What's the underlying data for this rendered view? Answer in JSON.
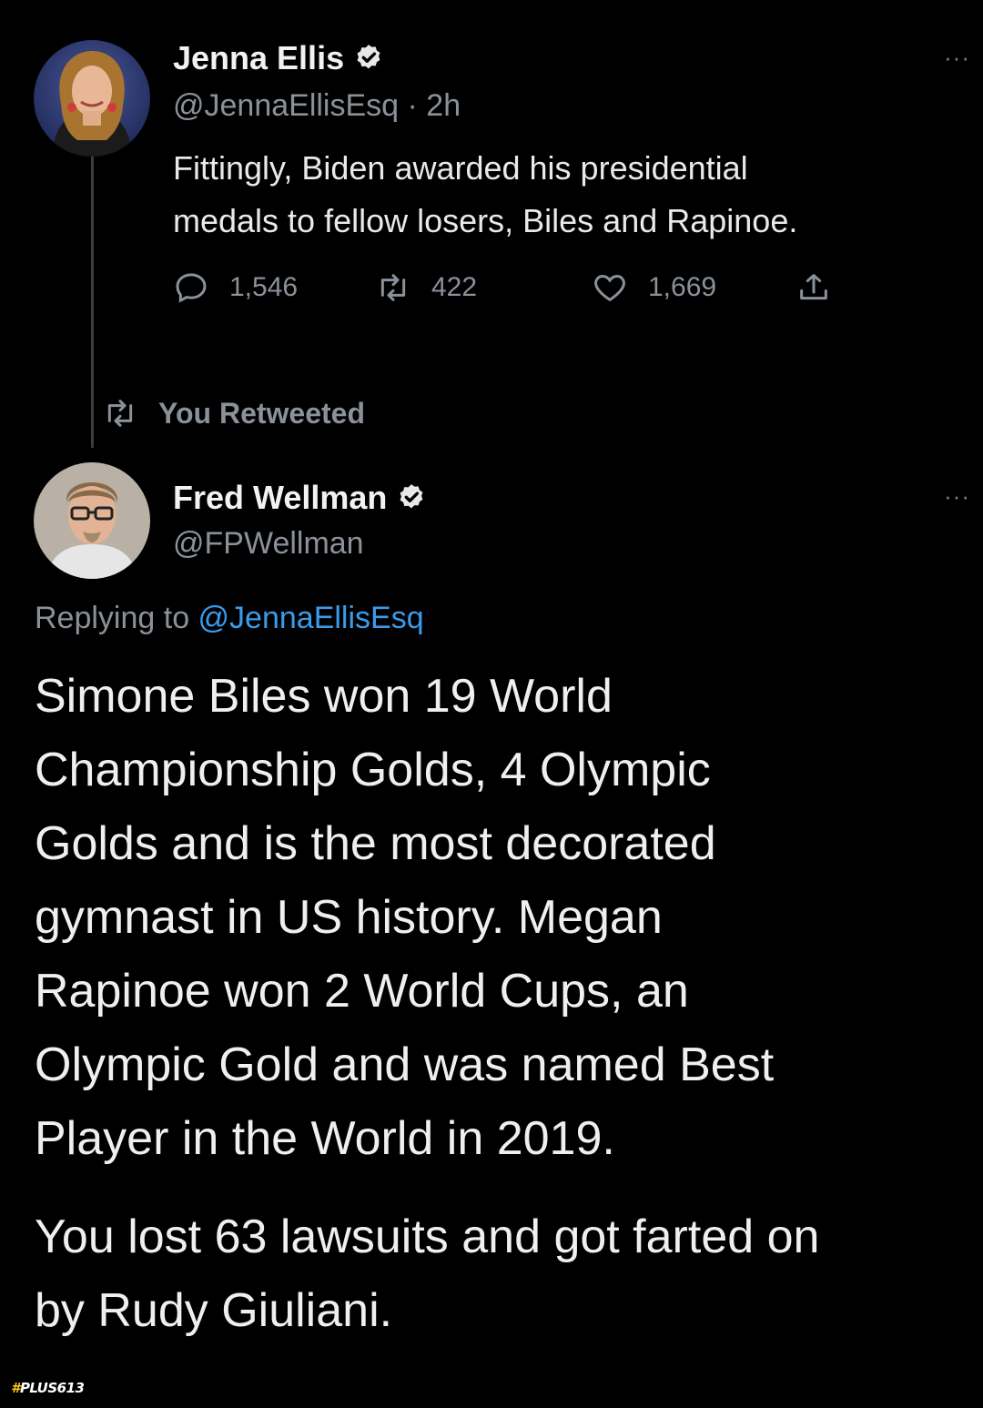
{
  "tweet1": {
    "name": "Jenna Ellis",
    "handle": "@JennaEllisEsq · 2h",
    "text_line1": "Fittingly, Biden awarded his presidential",
    "text_line2": "medals to fellow losers, Biles and Rapinoe.",
    "replies": "1,546",
    "retweets": "422",
    "likes": "1,669",
    "more": "···"
  },
  "retweet_notice": "You Retweeted",
  "tweet2": {
    "name": "Fred Wellman",
    "handle": "@FPWellman",
    "more": "···",
    "replying_prefix": "Replying to ",
    "replying_mention": "@JennaEllisEsq",
    "paragraph1": [
      "Simone Biles won 19 World",
      "Championship Golds, 4 Olympic",
      "Golds and is the most decorated",
      "gymnast in US history. Megan",
      "Rapinoe won 2 World Cups, an",
      "Olympic Gold and was named Best",
      "Player in the World in 2019."
    ],
    "paragraph2": [
      "You lost 63 lawsuits and got farted on",
      "by Rudy Giuliani."
    ]
  },
  "watermark": {
    "hash": "#",
    "text": "PLUS613"
  },
  "colors": {
    "background": "#000000",
    "text": "#e7e9ea",
    "secondary": "#8b9199",
    "link": "#3a9ceb"
  }
}
